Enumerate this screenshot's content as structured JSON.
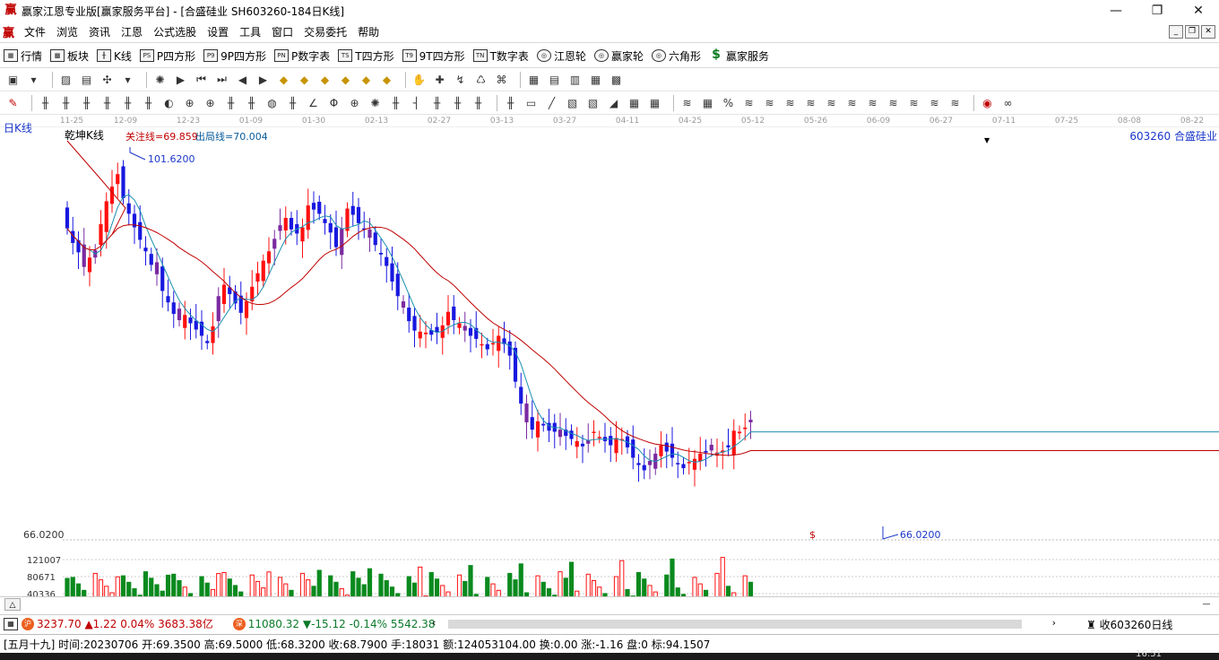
{
  "window": {
    "app_logo": "赢",
    "title": "赢家江恩专业版[赢家服务平台] - [合盛硅业  SH603260-184日K线]",
    "buttons": [
      "—",
      "❐",
      "✕"
    ]
  },
  "menu": {
    "logo": "赢",
    "items": [
      "文件",
      "浏览",
      "资讯",
      "江恩",
      "公式选股",
      "设置",
      "工具",
      "窗口",
      "交易委托",
      "帮助"
    ],
    "mdi_buttons": [
      "_",
      "❐",
      "✕"
    ]
  },
  "toolbar1": [
    {
      "icon": "grid-icon",
      "glyph": "▦",
      "label": "行情"
    },
    {
      "icon": "blocks-icon",
      "glyph": "▩",
      "label": "板块"
    },
    {
      "icon": "candle-icon",
      "glyph": "╫",
      "label": "K线"
    },
    {
      "icon": "ps-icon",
      "glyph": "PS",
      "label": "P四方形"
    },
    {
      "icon": "p9-icon",
      "glyph": "P9",
      "label": "9P四方形"
    },
    {
      "icon": "pn-icon",
      "glyph": "PN",
      "label": "P数字表"
    },
    {
      "icon": "ts-icon",
      "glyph": "TS",
      "label": "T四方形"
    },
    {
      "icon": "t9-icon",
      "glyph": "T9",
      "label": "9T四方形"
    },
    {
      "icon": "tn-icon",
      "glyph": "TN",
      "label": "T数字表"
    },
    {
      "icon": "wheel-icon",
      "glyph": "◎",
      "label": "江恩轮"
    },
    {
      "icon": "winner-wheel-icon",
      "glyph": "◎",
      "label": "赢家轮"
    },
    {
      "icon": "hexagon-icon",
      "glyph": "◎",
      "label": "六角形"
    },
    {
      "icon": "dollar-icon",
      "glyph": "$",
      "label": "赢家服务"
    }
  ],
  "toolbar2": [
    "▣",
    "▾",
    "▨",
    "▤",
    "✣",
    "▾",
    "✺",
    "▶",
    "⏮",
    "⏭",
    "◀",
    "▶",
    "◆",
    "◆",
    "◆",
    "◆",
    "◆",
    "◆",
    "✋",
    "✚",
    "↯",
    "♺",
    "⌘",
    "▦",
    "▤",
    "▥",
    "▦",
    "▩"
  ],
  "toolbar3": [
    "✎",
    "╫",
    "╫",
    "╫",
    "╫",
    "╫",
    "╫",
    "◐",
    "⊕",
    "⊕",
    "╫",
    "╫",
    "◍",
    "╫",
    "∠",
    "Φ",
    "⊕",
    "✺",
    "╫",
    "┤",
    "╫",
    "╫",
    "╫",
    "╫",
    "▭",
    "╱",
    "▧",
    "▧",
    "◢",
    "▦",
    "▦",
    "≋",
    "▦",
    "%",
    "≋",
    "≋",
    "≋",
    "≋",
    "≋",
    "≋",
    "≋",
    "≋",
    "≋",
    "≋",
    "≋",
    "◉",
    "∞"
  ],
  "chart": {
    "period_label": "日K线",
    "title": "乾坤K线",
    "attention_line": "关注线=69.859",
    "exit_line": "出局线=70.004",
    "symbol": "603260  合盛硅业",
    "high_marker": "101.6200",
    "low_marker": "66.0200",
    "axis_low": "66.0200",
    "vol_labels": [
      "121007",
      "80671",
      "40336"
    ],
    "dollar_marker": "$",
    "dates": [
      "11-25",
      "12-09",
      "12-23",
      "01-09",
      "01-30",
      "02-13",
      "02-27",
      "03-13",
      "03-27",
      "04-11",
      "04-25",
      "05-12",
      "05-26",
      "06-09",
      "06-27",
      "07-11",
      "07-25",
      "08-08",
      "08-22"
    ]
  },
  "chart_data": {
    "type": "candlestick",
    "title": "乾坤K线",
    "ylim": [
      66.02,
      101.62
    ],
    "closes": [
      95.2,
      93.8,
      92.9,
      91.5,
      92.4,
      93.1,
      95.6,
      97.8,
      99.2,
      100.4,
      98.1,
      96.6,
      95.3,
      94.1,
      93.0,
      91.7,
      90.8,
      89.2,
      88.1,
      87.0,
      86.4,
      86.9,
      86.1,
      85.5,
      84.9,
      84.2,
      85.8,
      88.7,
      89.8,
      88.9,
      88.0,
      87.1,
      88.2,
      89.6,
      90.9,
      92.1,
      93.0,
      94.2,
      95.5,
      96.2,
      95.1,
      94.7,
      95.3,
      97.4,
      97.0,
      96.6,
      95.7,
      94.8,
      93.4,
      95.2,
      97.1,
      96.5,
      95.7,
      95.1,
      94.3,
      93.6,
      92.7,
      91.6,
      90.1,
      88.7,
      87.6,
      86.3,
      85.4,
      85.3,
      85.2,
      85.0,
      85.2,
      85.9,
      87.2,
      86.4,
      86.1,
      85.4,
      84.9,
      84.6,
      84.1,
      83.6,
      84.2,
      84.9,
      84.1,
      83.0,
      80.5,
      78.4,
      76.6,
      75.9,
      76.7,
      76.3,
      75.8,
      75.7,
      75.9,
      75.3,
      75.0,
      74.8,
      74.3,
      74.9,
      75.7,
      75.2,
      74.8,
      74.4,
      75.1,
      75.0,
      74.2,
      73.2,
      72.5,
      72.0,
      72.9,
      73.6,
      74.4,
      73.8,
      73.2,
      72.6,
      72.2,
      72.8,
      73.1,
      73.6,
      73.7,
      73.9,
      73.7,
      73.9,
      74.2,
      75.8,
      75.7,
      76.1,
      76.6
    ],
    "ma_short_color": "#1a8fb0",
    "ma_long_color": "#c00000",
    "up_color": "#ff1010",
    "down_color": "#1818e0",
    "neutral_color": "#7b2aa1",
    "volume_up_color": "#ff1010",
    "volume_down_color": "#0a8a1e"
  },
  "status1": {
    "index1": "3237.70 ▲1.22 0.04% 3683.38亿",
    "index2": "11080.32 ▼-15.12 -0.14% 5542.38",
    "alert": "收603260日线"
  },
  "status2": {
    "text": "[五月十九] 时间:20230706 开:69.3500 高:69.5000 低:68.3200 收:68.7900 手:18031 额:124053104.00 换:0.00 涨:-1.16 盘:0 标:94.1507"
  },
  "taskbar": {
    "clock": "16:51"
  }
}
